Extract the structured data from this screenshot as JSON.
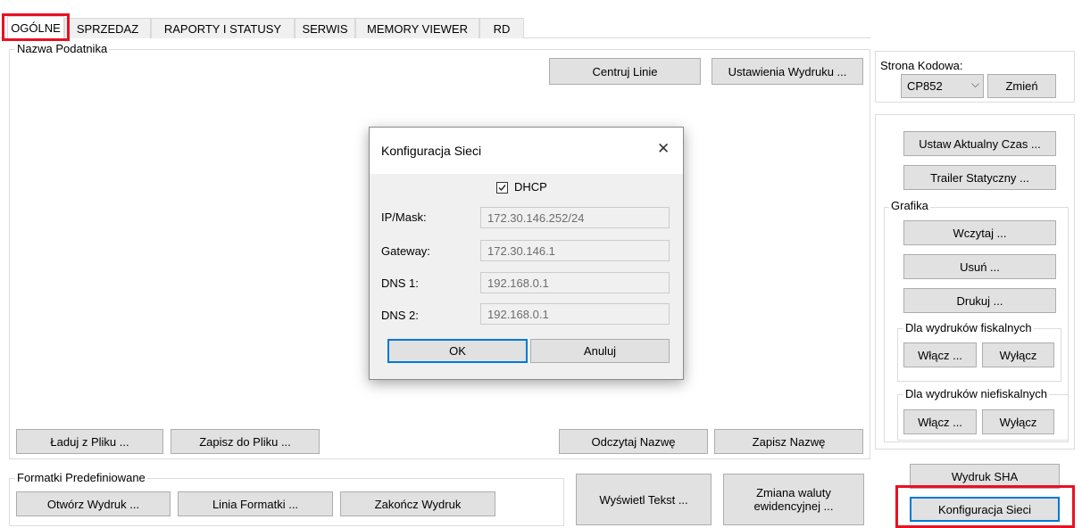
{
  "tabs": [
    {
      "label": "OGÓLNE"
    },
    {
      "label": "SPRZEDAZ"
    },
    {
      "label": "RAPORTY I STATUSY"
    },
    {
      "label": "SERWIS"
    },
    {
      "label": "MEMORY VIEWER"
    },
    {
      "label": "RD"
    }
  ],
  "nazwa_group": {
    "label": "Nazwa Podatnika",
    "centruj_label": "Centruj Linie",
    "ustawienia_label": "Ustawienia Wydruku ...",
    "laduj_label": "Ładuj z Pliku ...",
    "zapisz_plik_label": "Zapisz do Pliku ...",
    "odczytaj_label": "Odczytaj Nazwę",
    "zapisz_nazwe_label": "Zapisz Nazwę"
  },
  "formatki_group": {
    "label": "Formatki Predefiniowane",
    "otworz_label": "Otwórz Wydruk ...",
    "linia_label": "Linia Formatki ...",
    "zakoncz_label": "Zakończ Wydruk"
  },
  "wyswietl_label": "Wyświetl Tekst ...",
  "zmiana_label": "Zmiana waluty ewidencyjnej ...",
  "strona": {
    "label": "Strona Kodowa:",
    "selected": "CP852",
    "zmien_label": "Zmień"
  },
  "right_panel": {
    "ustaw_czas_label": "Ustaw Aktualny Czas ...",
    "trailer_label": "Trailer Statyczny ...",
    "grafika_label": "Grafika",
    "wczytaj_label": "Wczytaj ...",
    "usun_label": "Usuń ...",
    "drukuj_label": "Drukuj ...",
    "fiskalne_label": "Dla wydruków fiskalnych",
    "niefiskalne_label": "Dla wydruków niefiskalnych",
    "wlacz_label": "Włącz ...",
    "wylacz_label": "Wyłącz",
    "wydruk_sha_label": "Wydruk SHA",
    "konfiguracja_label": "Konfiguracja Sieci"
  },
  "dialog": {
    "title": "Konfiguracja Sieci",
    "close_glyph": "✕",
    "dhcp_label": "DHCP",
    "dhcp_checked": true,
    "ip_label": "IP/Mask:",
    "ip_value": "172.30.146.252/24",
    "gateway_label": "Gateway:",
    "gateway_value": "172.30.146.1",
    "dns1_label": "DNS 1:",
    "dns1_value": "192.168.0.1",
    "dns2_label": "DNS 2:",
    "dns2_value": "192.168.0.1",
    "ok_label": "OK",
    "anuluj_label": "Anuluj"
  },
  "colors": {
    "highlight_red": "#e81123",
    "button_bg": "#e1e1e1",
    "focus_blue": "#0078d7"
  }
}
